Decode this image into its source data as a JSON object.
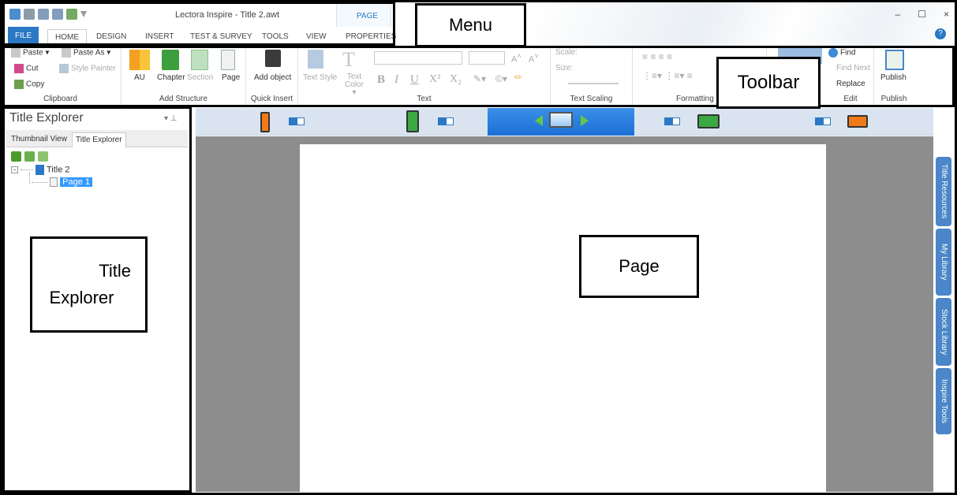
{
  "titlebar": {
    "app_title": "Lectora Inspire - Title 2.awt",
    "context_tab_label": "PAGE",
    "window_controls": [
      "–",
      "☐",
      "×"
    ]
  },
  "menu": {
    "tabs": [
      "FILE",
      "HOME",
      "DESIGN",
      "INSERT",
      "TEST & SURVEY",
      "TOOLS",
      "VIEW",
      "PROPERTIES"
    ],
    "active_tab": "HOME"
  },
  "ribbon": {
    "clipboard": {
      "paste": "Paste ▾",
      "paste_as": "Paste As ▾",
      "cut": "Cut",
      "style_painter": "Style Painter",
      "copy": "Copy",
      "label": "Clipboard"
    },
    "add_structure": {
      "au": "AU",
      "chapter": "Chapter",
      "section": "Section",
      "page": "Page",
      "label": "Add Structure"
    },
    "quick_insert": {
      "add_object": "Add object",
      "label": "Quick Insert"
    },
    "text": {
      "text_style": "Text Style",
      "text_color": "Text Color ▾",
      "bold": "B",
      "italic": "I",
      "underline": "U",
      "superscript": "X²",
      "subscript": "X₂",
      "label": "Text"
    },
    "text_scaling": {
      "scale": "Scale:",
      "size": "Size:",
      "label": "Text Scaling"
    },
    "formatting": {
      "label": "Formatting"
    },
    "edit": {
      "find": "Find",
      "find_next": "Find Next",
      "replace": "Replace",
      "label": "Edit"
    },
    "publish": {
      "publish": "Publish",
      "label": "Publish"
    }
  },
  "explorer": {
    "header": "Title Explorer",
    "tabs": [
      "Thumbnail View",
      "Title Explorer"
    ],
    "tree": {
      "title": "Title 2",
      "page": "Page 1"
    }
  },
  "dock_tabs": [
    "Title Resources",
    "My Library",
    "Stock Library",
    "Inspire Tools"
  ],
  "annotations": {
    "menu": "Menu",
    "toolbar": "Toolbar",
    "explorer_line1": "Title",
    "explorer_line2": "Explorer",
    "page": "Page"
  },
  "colors": {
    "accent": "#2b78c5",
    "device_bar": "#d9e4f0",
    "canvas": "#8d8d8d",
    "dock_tab": "#4a86c8"
  }
}
